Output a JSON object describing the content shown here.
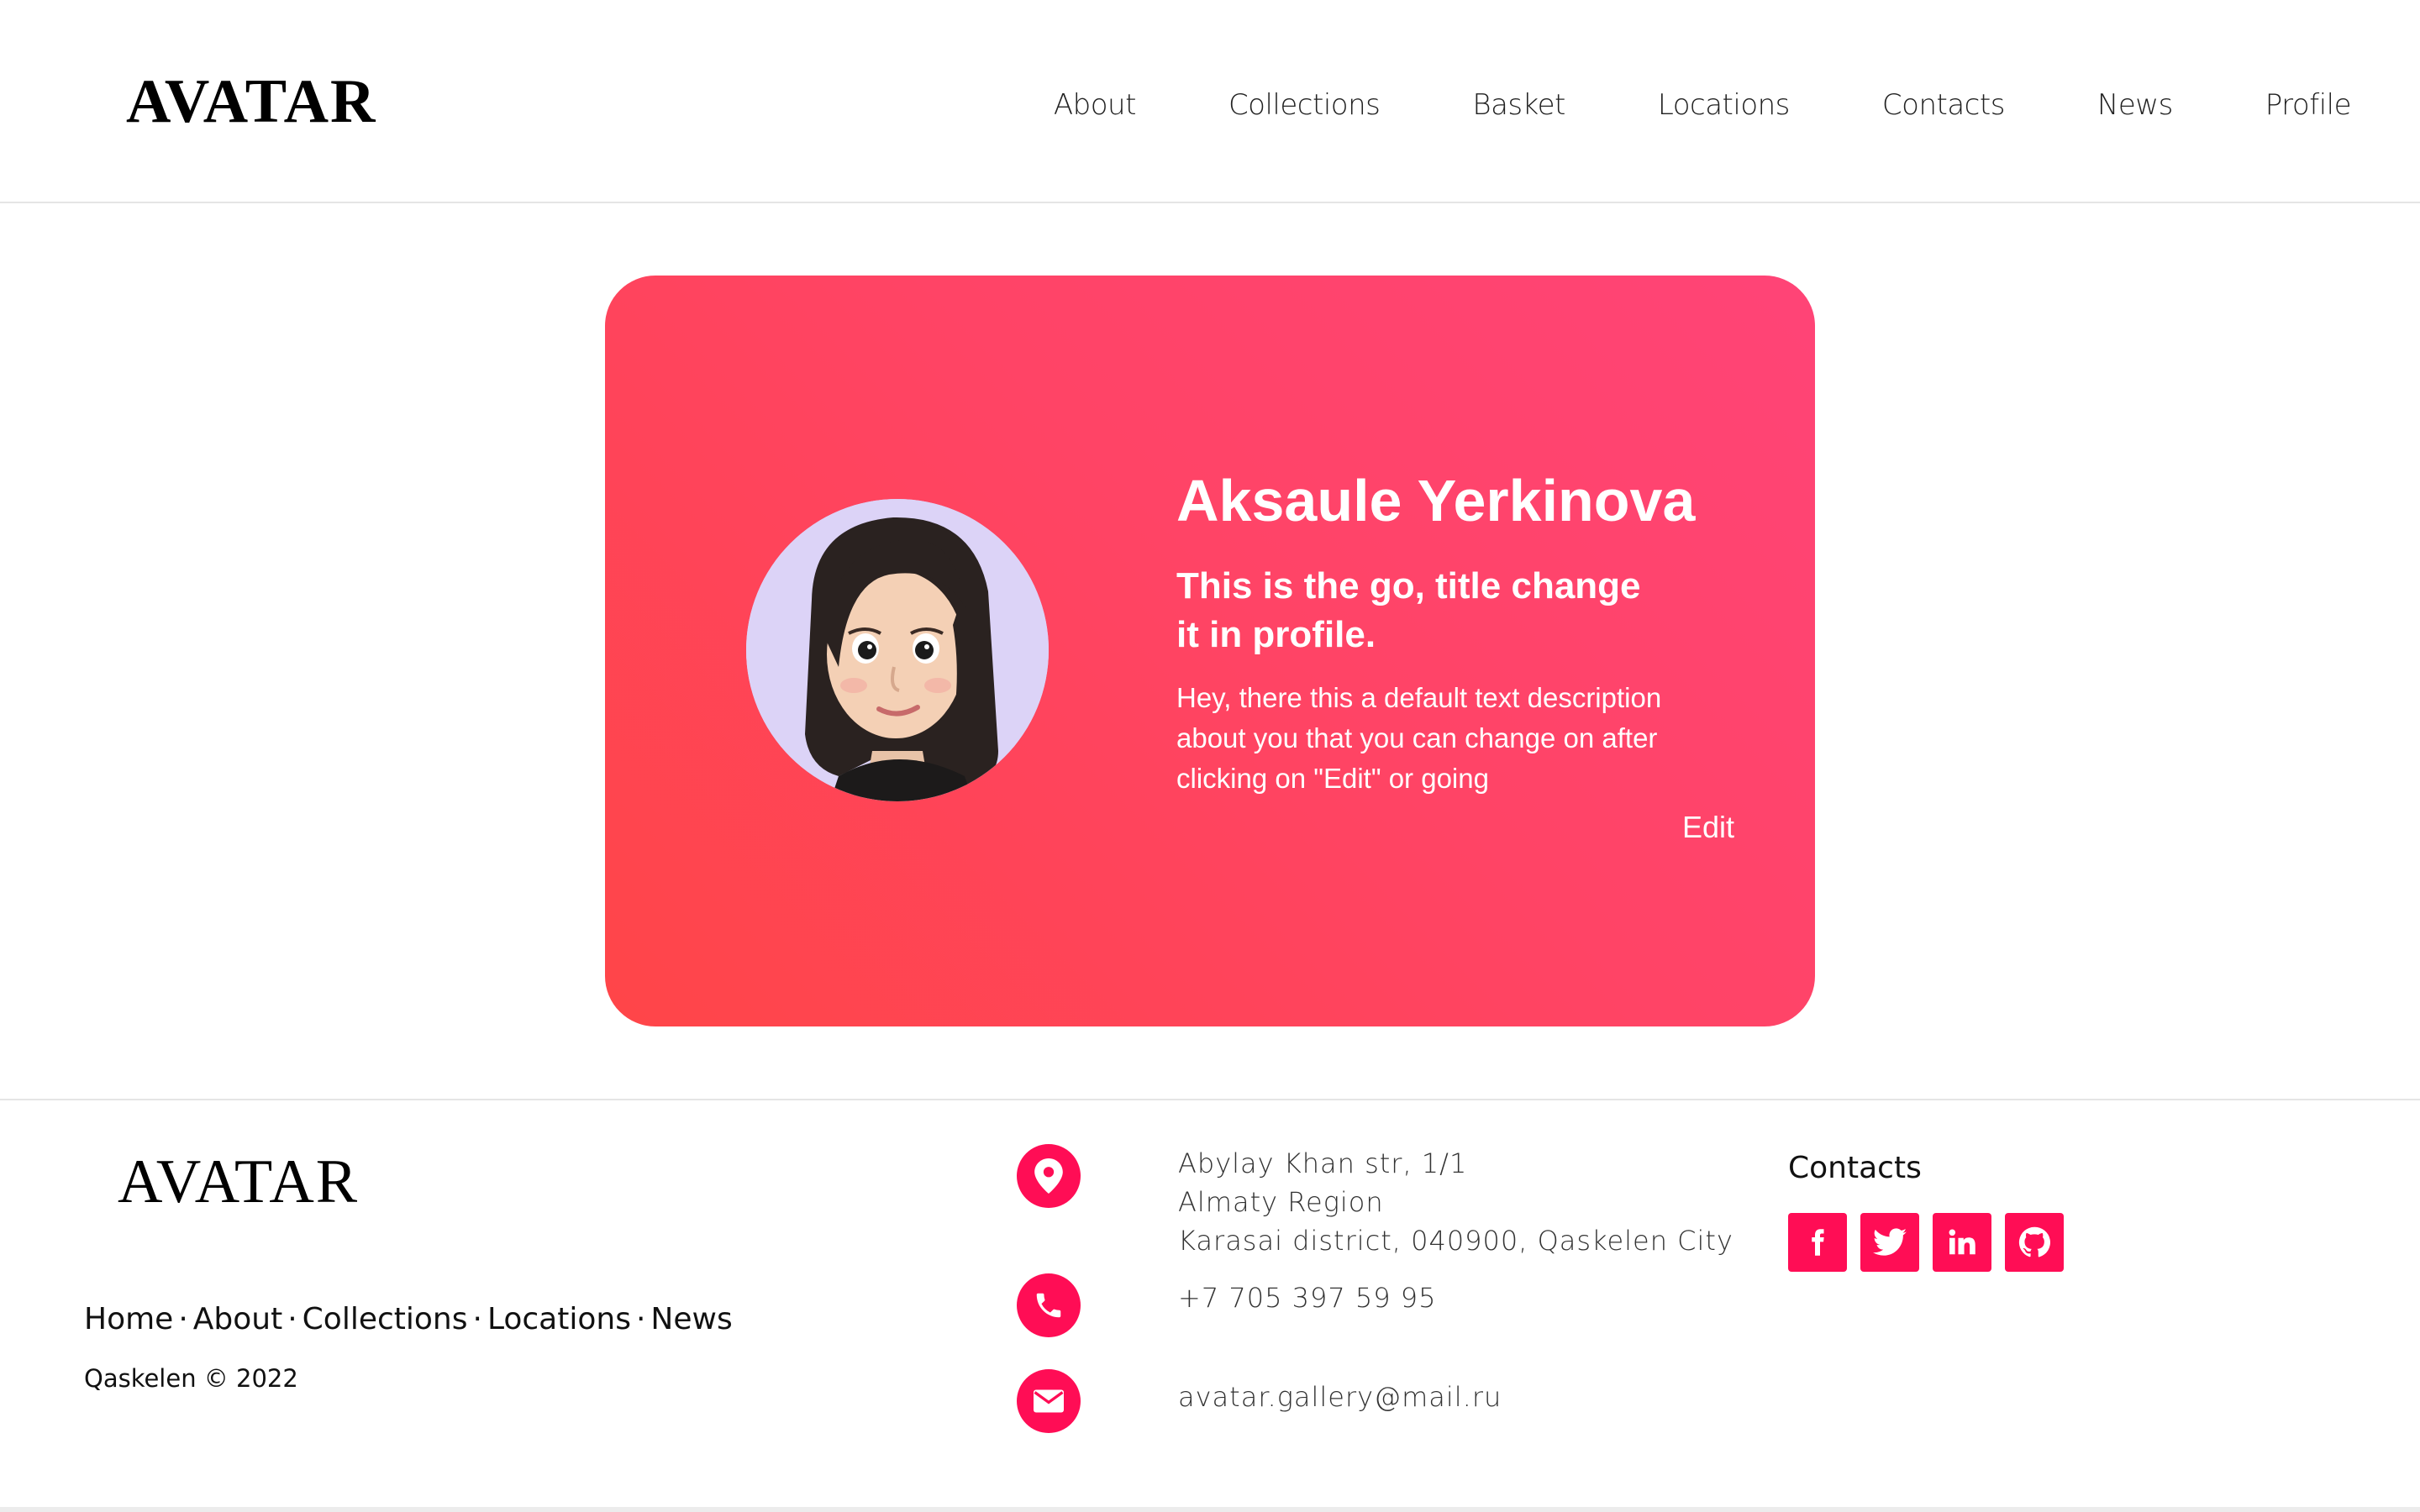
{
  "brand": {
    "name": "AVATAR"
  },
  "nav": {
    "items": [
      {
        "label": "About"
      },
      {
        "label": "Collections"
      },
      {
        "label": "Basket"
      },
      {
        "label": "Locations"
      },
      {
        "label": "Contacts"
      },
      {
        "label": "News"
      },
      {
        "label": "Profile"
      }
    ]
  },
  "profile": {
    "name": "Aksaule Yerkinova",
    "title": "This is the go, title change it in profile.",
    "description": "Hey, there this a default text description about you that you can change on after clicking on \"Edit\" or going",
    "edit_label": "Edit",
    "avatar_icon": "memoji-avatar"
  },
  "footer": {
    "brand": "AVATAR",
    "links": [
      {
        "label": "Home"
      },
      {
        "label": "About"
      },
      {
        "label": "Collections"
      },
      {
        "label": "Locations"
      },
      {
        "label": "News"
      }
    ],
    "separator": "·",
    "copyright": "Qaskelen © 2022",
    "address": {
      "line1": "Abylay Khan str, 1/1",
      "line2": "Almaty Region",
      "line3": "Karasai district, 040900, Qaskelen City",
      "icon": "map-pin-icon"
    },
    "phone": {
      "value": "+7 705 397 59 95",
      "icon": "phone-icon"
    },
    "email": {
      "value": "avatar.gallery@mail.ru",
      "icon": "envelope-icon"
    },
    "contacts_title": "Contacts",
    "socials": [
      {
        "name": "facebook-icon"
      },
      {
        "name": "twitter-icon"
      },
      {
        "name": "linkedin-icon"
      },
      {
        "name": "github-icon"
      }
    ]
  },
  "colors": {
    "accent": "#ff0d55",
    "card_gradient_start": "#ff4548",
    "card_gradient_end": "#ff4477",
    "avatar_bg": "#dcd3f7"
  }
}
